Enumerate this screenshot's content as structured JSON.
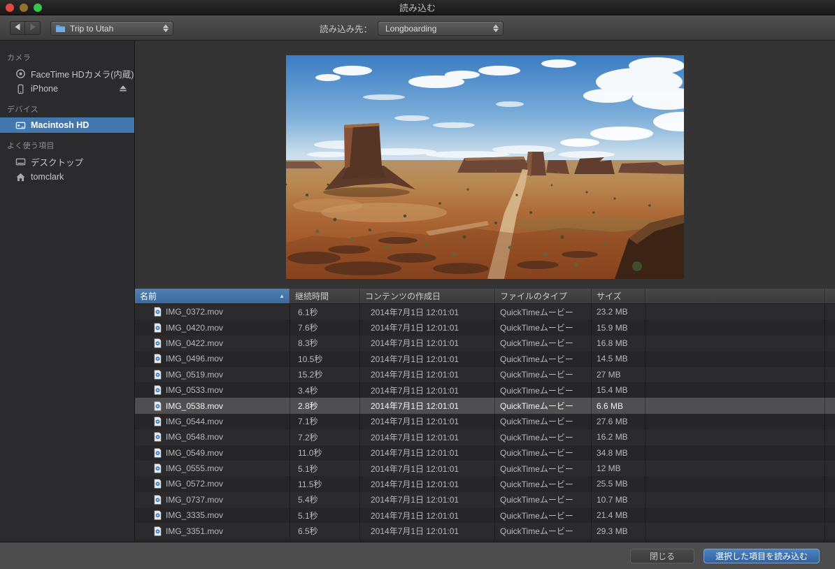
{
  "window": {
    "title": "読み込む"
  },
  "toolbar": {
    "back_icon": "back-arrow",
    "forward_icon": "forward-arrow",
    "source_folder": "Trip to Utah",
    "source_folder_icon": "blue-folder",
    "destination_label": "読み込み先：",
    "destination_value": "Longboarding"
  },
  "sidebar": {
    "sections": [
      {
        "title": "カメラ",
        "items": [
          {
            "id": "facetime-hd-camera",
            "icon": "facetime-camera-icon",
            "label": "FaceTime HDカメラ(内蔵)"
          },
          {
            "id": "iphone",
            "icon": "iphone-icon",
            "label": "iPhone",
            "eject": true
          }
        ]
      },
      {
        "title": "デバイス",
        "items": [
          {
            "id": "macintosh-hd",
            "icon": "hard-drive-icon",
            "label": "Macintosh HD",
            "selected": true
          }
        ]
      },
      {
        "title": "よく使う項目",
        "items": [
          {
            "id": "desktop",
            "icon": "desktop-icon",
            "label": "デスクトップ"
          },
          {
            "id": "tomclark",
            "icon": "home-icon",
            "label": "tomclark"
          }
        ]
      }
    ]
  },
  "preview": {
    "description": "Monument Valley desert vista: large butte at left, distant mesas, red desert floor, dirt road, blue sky with clouds"
  },
  "table": {
    "columns": [
      {
        "key": "name",
        "label": "名前",
        "sorted": "asc"
      },
      {
        "key": "duration",
        "label": "継続時間"
      },
      {
        "key": "created",
        "label": "コンテンツの作成日"
      },
      {
        "key": "type",
        "label": "ファイルのタイプ"
      },
      {
        "key": "size",
        "label": "サイズ"
      }
    ],
    "rows": [
      {
        "name": "IMG_0372.mov",
        "duration": "6.1秒",
        "created": "2014年7月1日 12:01:01",
        "type": "QuickTimeムービー",
        "size": "23.2 MB"
      },
      {
        "name": "IMG_0420.mov",
        "duration": "7.6秒",
        "created": "2014年7月1日 12:01:01",
        "type": "QuickTimeムービー",
        "size": "15.9 MB"
      },
      {
        "name": "IMG_0422.mov",
        "duration": "8.3秒",
        "created": "2014年7月1日 12:01:01",
        "type": "QuickTimeムービー",
        "size": "16.8 MB"
      },
      {
        "name": "IMG_0496.mov",
        "duration": "10.5秒",
        "created": "2014年7月1日 12:01:01",
        "type": "QuickTimeムービー",
        "size": "14.5 MB"
      },
      {
        "name": "IMG_0519.mov",
        "duration": "15.2秒",
        "created": "2014年7月1日 12:01:01",
        "type": "QuickTimeムービー",
        "size": "27 MB"
      },
      {
        "name": "IMG_0533.mov",
        "duration": "3.4秒",
        "created": "2014年7月1日 12:01:01",
        "type": "QuickTimeムービー",
        "size": "15.4 MB"
      },
      {
        "name": "IMG_0538.mov",
        "duration": "2.8秒",
        "created": "2014年7月1日 12:01:01",
        "type": "QuickTimeムービー",
        "size": "6.6 MB",
        "selected": true
      },
      {
        "name": "IMG_0544.mov",
        "duration": "7.1秒",
        "created": "2014年7月1日 12:01:01",
        "type": "QuickTimeムービー",
        "size": "27.6 MB"
      },
      {
        "name": "IMG_0548.mov",
        "duration": "7.2秒",
        "created": "2014年7月1日 12:01:01",
        "type": "QuickTimeムービー",
        "size": "16.2 MB"
      },
      {
        "name": "IMG_0549.mov",
        "duration": "11.0秒",
        "created": "2014年7月1日 12:01:01",
        "type": "QuickTimeムービー",
        "size": "34.8 MB"
      },
      {
        "name": "IMG_0555.mov",
        "duration": "5.1秒",
        "created": "2014年7月1日 12:01:01",
        "type": "QuickTimeムービー",
        "size": "12 MB"
      },
      {
        "name": "IMG_0572.mov",
        "duration": "11.5秒",
        "created": "2014年7月1日 12:01:01",
        "type": "QuickTimeムービー",
        "size": "25.5 MB"
      },
      {
        "name": "IMG_0737.mov",
        "duration": "5.4秒",
        "created": "2014年7月1日 12:01:01",
        "type": "QuickTimeムービー",
        "size": "10.7 MB"
      },
      {
        "name": "IMG_3335.mov",
        "duration": "5.1秒",
        "created": "2014年7月1日 12:01:01",
        "type": "QuickTimeムービー",
        "size": "21.4 MB"
      },
      {
        "name": "IMG_3351.mov",
        "duration": "6.5秒",
        "created": "2014年7月1日 12:01:01",
        "type": "QuickTimeムービー",
        "size": "29.3 MB"
      }
    ]
  },
  "footer": {
    "close_label": "閉じる",
    "import_label": "選択した項目を読み込む"
  },
  "colors": {
    "accent_blue": "#4278ae",
    "sorted_header_blue": "#3c689d",
    "selection_gray": "#4f4f52",
    "import_button_blue": "#3d74b4"
  }
}
